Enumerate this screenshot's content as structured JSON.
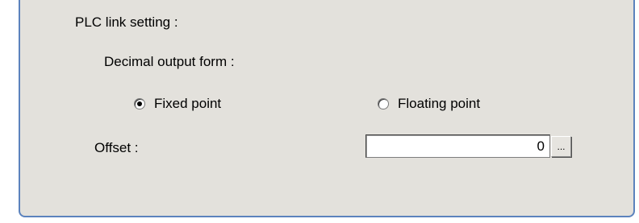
{
  "group": {
    "title": "PLC link setting :",
    "decimal_output_label": "Decimal output form :",
    "options": [
      {
        "label": "Fixed point",
        "selected": true
      },
      {
        "label": "Floating point",
        "selected": false
      }
    ],
    "offset_label": "Offset :",
    "offset_value": "0",
    "browse_label": "..."
  },
  "colors": {
    "panel_background": "#e3e1dc",
    "panel_border": "#5b82bd"
  }
}
